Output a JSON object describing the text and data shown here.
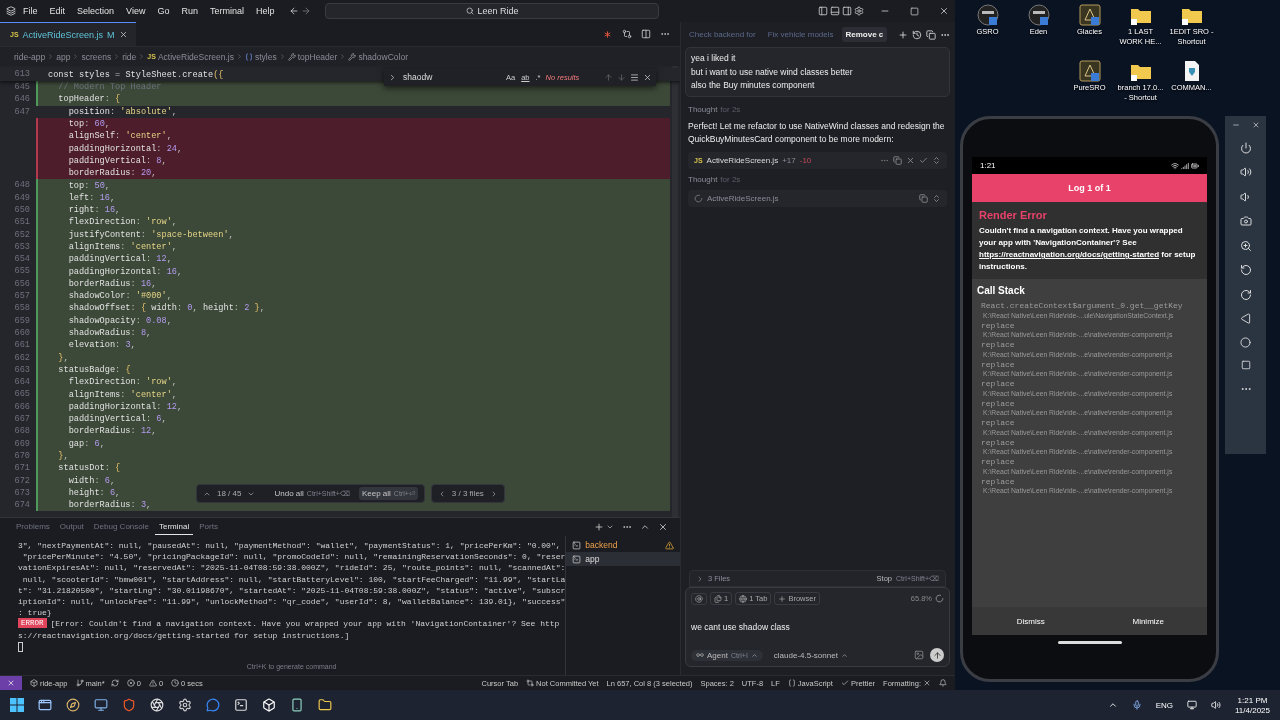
{
  "window": {
    "title": "Leen Ride",
    "menu": [
      "File",
      "Edit",
      "Selection",
      "View",
      "Go",
      "Run",
      "Terminal",
      "Help"
    ]
  },
  "editor_tab": {
    "file_type": "JS",
    "label": "ActiveRideScreen.js",
    "badge": "M",
    "selected": true
  },
  "breadcrumb": [
    {
      "label": "ride-app",
      "kind": "folder"
    },
    {
      "label": "app",
      "kind": "folder"
    },
    {
      "label": "screens",
      "kind": "folder"
    },
    {
      "label": "ride",
      "kind": "folder"
    },
    {
      "label": "ActiveRideScreen.js",
      "kind": "file",
      "file_type": "JS"
    },
    {
      "label": "styles",
      "kind": "symbol"
    },
    {
      "label": "topHeader",
      "kind": "property"
    },
    {
      "label": "shadowColor",
      "kind": "property"
    }
  ],
  "sticky_line": {
    "number": "613",
    "text": "const styles = StyleSheet.create({"
  },
  "code_lines": [
    {
      "number": "645",
      "text": "  // Modern Top Header",
      "kind": "added"
    },
    {
      "number": "646",
      "text": "  topHeader: {",
      "kind": "added"
    },
    {
      "number": "647",
      "text": "    position: 'absolute',",
      "kind": "normal"
    },
    {
      "text": "    top: 60,",
      "kind": "removed"
    },
    {
      "text": "    alignSelf: 'center',",
      "kind": "removed"
    },
    {
      "text": "    paddingHorizontal: 24,",
      "kind": "removed"
    },
    {
      "text": "    paddingVertical: 8,",
      "kind": "removed"
    },
    {
      "text": "    borderRadius: 20,",
      "kind": "removed"
    },
    {
      "number": "648",
      "text": "    top: 50,",
      "kind": "added"
    },
    {
      "number": "649",
      "text": "    left: 16,",
      "kind": "added"
    },
    {
      "number": "650",
      "text": "    right: 16,",
      "kind": "added"
    },
    {
      "number": "651",
      "text": "    flexDirection: 'row',",
      "kind": "added"
    },
    {
      "number": "652",
      "text": "    justifyContent: 'space-between',",
      "kind": "added"
    },
    {
      "number": "653",
      "text": "    alignItems: 'center',",
      "kind": "added"
    },
    {
      "number": "654",
      "text": "    paddingVertical: 12,",
      "kind": "added"
    },
    {
      "number": "655",
      "text": "    paddingHorizontal: 16,",
      "kind": "added"
    },
    {
      "number": "656",
      "text": "    borderRadius: 16,",
      "kind": "added"
    },
    {
      "number": "657",
      "text": "    shadowColor: '#000',",
      "kind": "added"
    },
    {
      "number": "658",
      "text": "    shadowOffset: { width: 0, height: 2 },",
      "kind": "added"
    },
    {
      "number": "659",
      "text": "    shadowOpacity: 0.08,",
      "kind": "added"
    },
    {
      "number": "660",
      "text": "    shadowRadius: 8,",
      "kind": "added"
    },
    {
      "number": "661",
      "text": "    elevation: 3,",
      "kind": "added"
    },
    {
      "number": "662",
      "text": "  },",
      "kind": "added"
    },
    {
      "number": "663",
      "text": "  statusBadge: {",
      "kind": "added"
    },
    {
      "number": "664",
      "text": "    flexDirection: 'row',",
      "kind": "added"
    },
    {
      "number": "665",
      "text": "    alignItems: 'center',",
      "kind": "added"
    },
    {
      "number": "666",
      "text": "    paddingHorizontal: 12,",
      "kind": "added"
    },
    {
      "number": "667",
      "text": "    paddingVertical: 6,",
      "kind": "added"
    },
    {
      "number": "668",
      "text": "    borderRadius: 12,",
      "kind": "added"
    },
    {
      "number": "669",
      "text": "    gap: 6,",
      "kind": "added"
    },
    {
      "number": "670",
      "text": "  },",
      "kind": "added"
    },
    {
      "number": "671",
      "text": "  statusDot: {",
      "kind": "added"
    },
    {
      "number": "672",
      "text": "    width: 6,",
      "kind": "added"
    },
    {
      "number": "673",
      "text": "    height: 6,",
      "kind": "added"
    },
    {
      "number": "674",
      "text": "    borderRadius: 3,",
      "kind": "added"
    }
  ],
  "find_widget": {
    "value": "shaodw",
    "options": [
      "Aa",
      "ab",
      ".*"
    ],
    "status": "No results"
  },
  "review_bar": {
    "position": "18 / 45",
    "undo": {
      "label": "Undo all",
      "shortcut": "Ctrl+Shift+⌫"
    },
    "keep": {
      "label": "Keep all",
      "shortcut": "Ctrl+⏎"
    },
    "files": "3 / 3 files"
  },
  "panel": {
    "tabs": [
      {
        "label": "Problems",
        "selected": false
      },
      {
        "label": "Output",
        "selected": false
      },
      {
        "label": "Debug Console",
        "selected": false
      },
      {
        "label": "Terminal",
        "selected": true
      },
      {
        "label": "Ports",
        "selected": false
      }
    ],
    "terminal_lines": [
      "3\", \"nextPaymentAt\": null, \"pausedAt\": null, \"paymentMethod\": \"wallet\", \"paymentStatus\": 1, \"pricePerKm\": \"0.00\",",
      " \"pricePerMinute\": \"4.50\", \"pricingPackageId\": null, \"promoCodeId\": null, \"remainingReservationSeconds\": 0, \"reser",
      "vationExpiresAt\": null, \"reservedAt\": \"2025-11-04T08:59:38.000Z\", \"rideId\": 25, \"route_points\": null, \"scannedAt\":",
      " null, \"scooterId\": \"bmw001\", \"startAddress\": null, \"startBatteryLevel\": 100, \"startFeeCharged\": \"11.99\", \"startLa",
      "t\": \"31.21820500\", \"startLng\": \"30.01198670\", \"startedAt\": \"2025-11-04T08:59:38.000Z\", \"status\": \"active\", \"subscr",
      "iptionId\": null, \"unlockFee\": \"11.99\", \"unlockMethod\": \"qr_code\", \"userId\": 8, \"walletBalance\": 139.01}, \"success\"",
      ": true}"
    ],
    "error": {
      "badge": "ERROR",
      "lines": [
        "[Error: Couldn't find a navigation context. Have you wrapped your app with 'NavigationContainer'? See http",
        "s://reactnavigation.org/docs/getting-started for setup instructions.]"
      ]
    },
    "hint": "Ctrl+K to generate command",
    "sessions": [
      {
        "label": "backend",
        "warning": true,
        "selected": false
      },
      {
        "label": "app",
        "warning": false,
        "selected": true
      }
    ]
  },
  "status_bar": {
    "left": [
      {
        "kind": "folder",
        "label": "ride-app"
      },
      {
        "kind": "branch",
        "label": "main*"
      },
      {
        "kind": "errors",
        "label": "0"
      },
      {
        "kind": "warnings",
        "label": "0"
      },
      {
        "kind": "time",
        "label": "0 secs"
      }
    ],
    "right": [
      {
        "kind": "text",
        "label": "Cursor Tab"
      },
      {
        "kind": "commit",
        "label": "Not Committed Yet"
      },
      {
        "kind": "text",
        "label": "Ln 657, Col 8 (3 selected)"
      },
      {
        "kind": "text",
        "label": "Spaces: 2"
      },
      {
        "kind": "text",
        "label": "UTF-8"
      },
      {
        "kind": "text",
        "label": "LF"
      },
      {
        "kind": "language",
        "label": "JavaScript"
      },
      {
        "kind": "check",
        "label": "Prettier"
      },
      {
        "kind": "off",
        "label": "Formatting:"
      }
    ]
  },
  "chat": {
    "tabs": [
      {
        "label": "Check backend for",
        "selected": false
      },
      {
        "label": "Fix vehicle models",
        "selected": false
      },
      {
        "label": "Remove c",
        "selected": true
      }
    ],
    "user_message": [
      "yea i liked it",
      "but i want to use native wind classes better",
      "also the Buy minutes component"
    ],
    "messages": [
      {
        "kind": "thought",
        "label": "Thought",
        "duration": "for 2s"
      },
      {
        "kind": "text",
        "text": "Perfect! Let me refactor to use NativeWind classes and redesign the QuickBuyMinutesCard component to be more modern:"
      },
      {
        "kind": "file",
        "file_type": "JS",
        "name": "ActiveRideScreen.js",
        "added": "+17",
        "removed": "-10"
      },
      {
        "kind": "thought",
        "label": "Thought",
        "duration": "for 2s"
      },
      {
        "kind": "pending_file",
        "name": "ActiveRideScreen.js"
      }
    ],
    "files_row": {
      "label": "3 Files",
      "stop": "Stop",
      "shortcut": "Ctrl+Shift+⌫"
    },
    "composer": {
      "chips": [
        {
          "kind": "count",
          "label": "1"
        },
        {
          "kind": "tab",
          "label": "1 Tab"
        },
        {
          "kind": "browser",
          "label": "Browser"
        }
      ],
      "usage": "65.8%",
      "value": "we cant use shadow class",
      "mode": "Agent",
      "mode_shortcut": "Ctrl+I",
      "model": "claude-4.5-sonnet"
    }
  },
  "desktop_icons": [
    {
      "label": "GSRO",
      "kind": "app"
    },
    {
      "label": "Eden",
      "kind": "app"
    },
    {
      "label": "Glacies",
      "kind": "game"
    },
    {
      "label": "1 LAST WORK HE...",
      "kind": "folder"
    },
    {
      "label": "1EDIT SRO - Shortcut",
      "kind": "folder"
    },
    {
      "label": "PureSRO",
      "kind": "game"
    },
    {
      "label": "branch 17.0... - Shortcut",
      "kind": "folder"
    },
    {
      "label": "COMMAN...",
      "kind": "file"
    }
  ],
  "phone": {
    "time": "1:21",
    "header": "Log 1 of 1",
    "title": "Render Error",
    "message_before": "Couldn't find a navigation context. Have you wrapped your app with 'NavigationContainer'? See ",
    "link": "https://reactnavigation.org/docs/getting-started",
    "message_after": " for setup instructions.",
    "stack_title": "Call Stack",
    "frames": [
      {
        "method": "React.createContext$argument_0.get__getKey",
        "file": "K:\\React Native\\Leen Ride\\ride-...ule\\NavigationStateContext.js"
      },
      {
        "method": "replace",
        "file": "K:\\React Native\\Leen Ride\\ride-...e\\native\\render-component.js"
      },
      {
        "method": "replace",
        "file": "K:\\React Native\\Leen Ride\\ride-...e\\native\\render-component.js"
      },
      {
        "method": "replace",
        "file": "K:\\React Native\\Leen Ride\\ride-...e\\native\\render-component.js"
      },
      {
        "method": "replace",
        "file": "K:\\React Native\\Leen Ride\\ride-...e\\native\\render-component.js"
      },
      {
        "method": "replace",
        "file": "K:\\React Native\\Leen Ride\\ride-...e\\native\\render-component.js"
      },
      {
        "method": "replace",
        "file": "K:\\React Native\\Leen Ride\\ride-...e\\native\\render-component.js"
      },
      {
        "method": "replace",
        "file": "K:\\React Native\\Leen Ride\\ride-...e\\native\\render-component.js"
      },
      {
        "method": "replace",
        "file": "K:\\React Native\\Leen Ride\\ride-...e\\native\\render-component.js"
      },
      {
        "method": "replace",
        "file": "K:\\React Native\\Leen Ride\\ride-...e\\native\\render-component.js"
      }
    ],
    "buttons": [
      "Dismiss",
      "Minimize"
    ]
  },
  "taskbar": {
    "language": "ENG",
    "time": "1:21 PM",
    "date": "11/4/2025"
  }
}
